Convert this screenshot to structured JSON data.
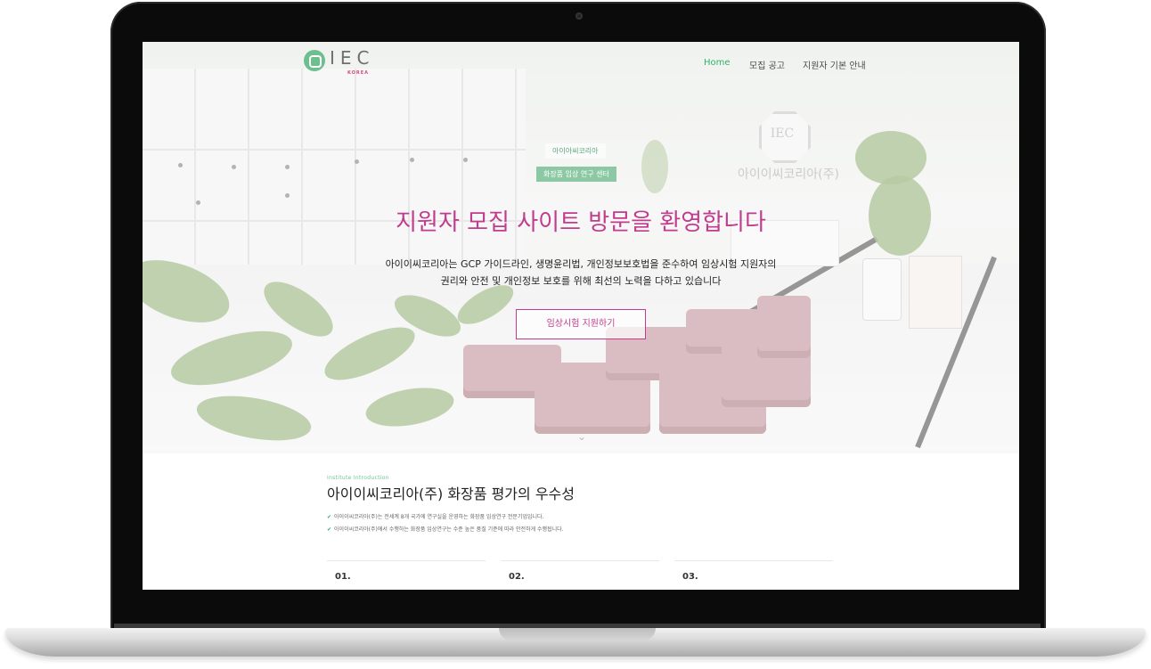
{
  "nav": {
    "logo_text": "IEC",
    "logo_sub": "KOREA",
    "items": [
      {
        "label": "Home",
        "active": true
      },
      {
        "label": "모집 공고",
        "active": false
      },
      {
        "label": "지원자 기본 안내",
        "active": false
      }
    ]
  },
  "hero": {
    "badge1": "아이아씨코리아",
    "badge2": "화장품 임상 연구 센터",
    "wall_logo": "IEC",
    "wall_name": "아이이씨코리아(주)",
    "title": "지원자 모집 사이트 방문을 환영합니다",
    "desc_line1": "아이이씨코리아는 GCP 가이드라인, 생명윤리법, 개인정보보호법을 준수하여 임상시험 지원자의",
    "desc_line2": "권리와 안전 및 개인정보 보호를 위해 최선의 노력을 다하고 있습니다",
    "cta": "임상시험 지원하기",
    "scroll_icon": "chevron-down-icon"
  },
  "intro": {
    "eyebrow": "Institute Introduction",
    "title": "아이이씨코리아(주) 화장품 평가의 우수성",
    "bullets": [
      "아이이씨코리아(주)는 전세계 8개 국가에 연구실을 운영하는 화장품 임상연구 전문기업입니다.",
      "아이이씨코리아(주)에서 수행하는 화장품 임상연구는 수준 높은 품질 기준에 따라 안전하게 수행됩니다."
    ],
    "cards": [
      "01.",
      "02.",
      "03."
    ]
  },
  "colors": {
    "accent_pink": "#c13c8d",
    "accent_green": "#2db369",
    "logo_green": "#6dbf8e"
  }
}
